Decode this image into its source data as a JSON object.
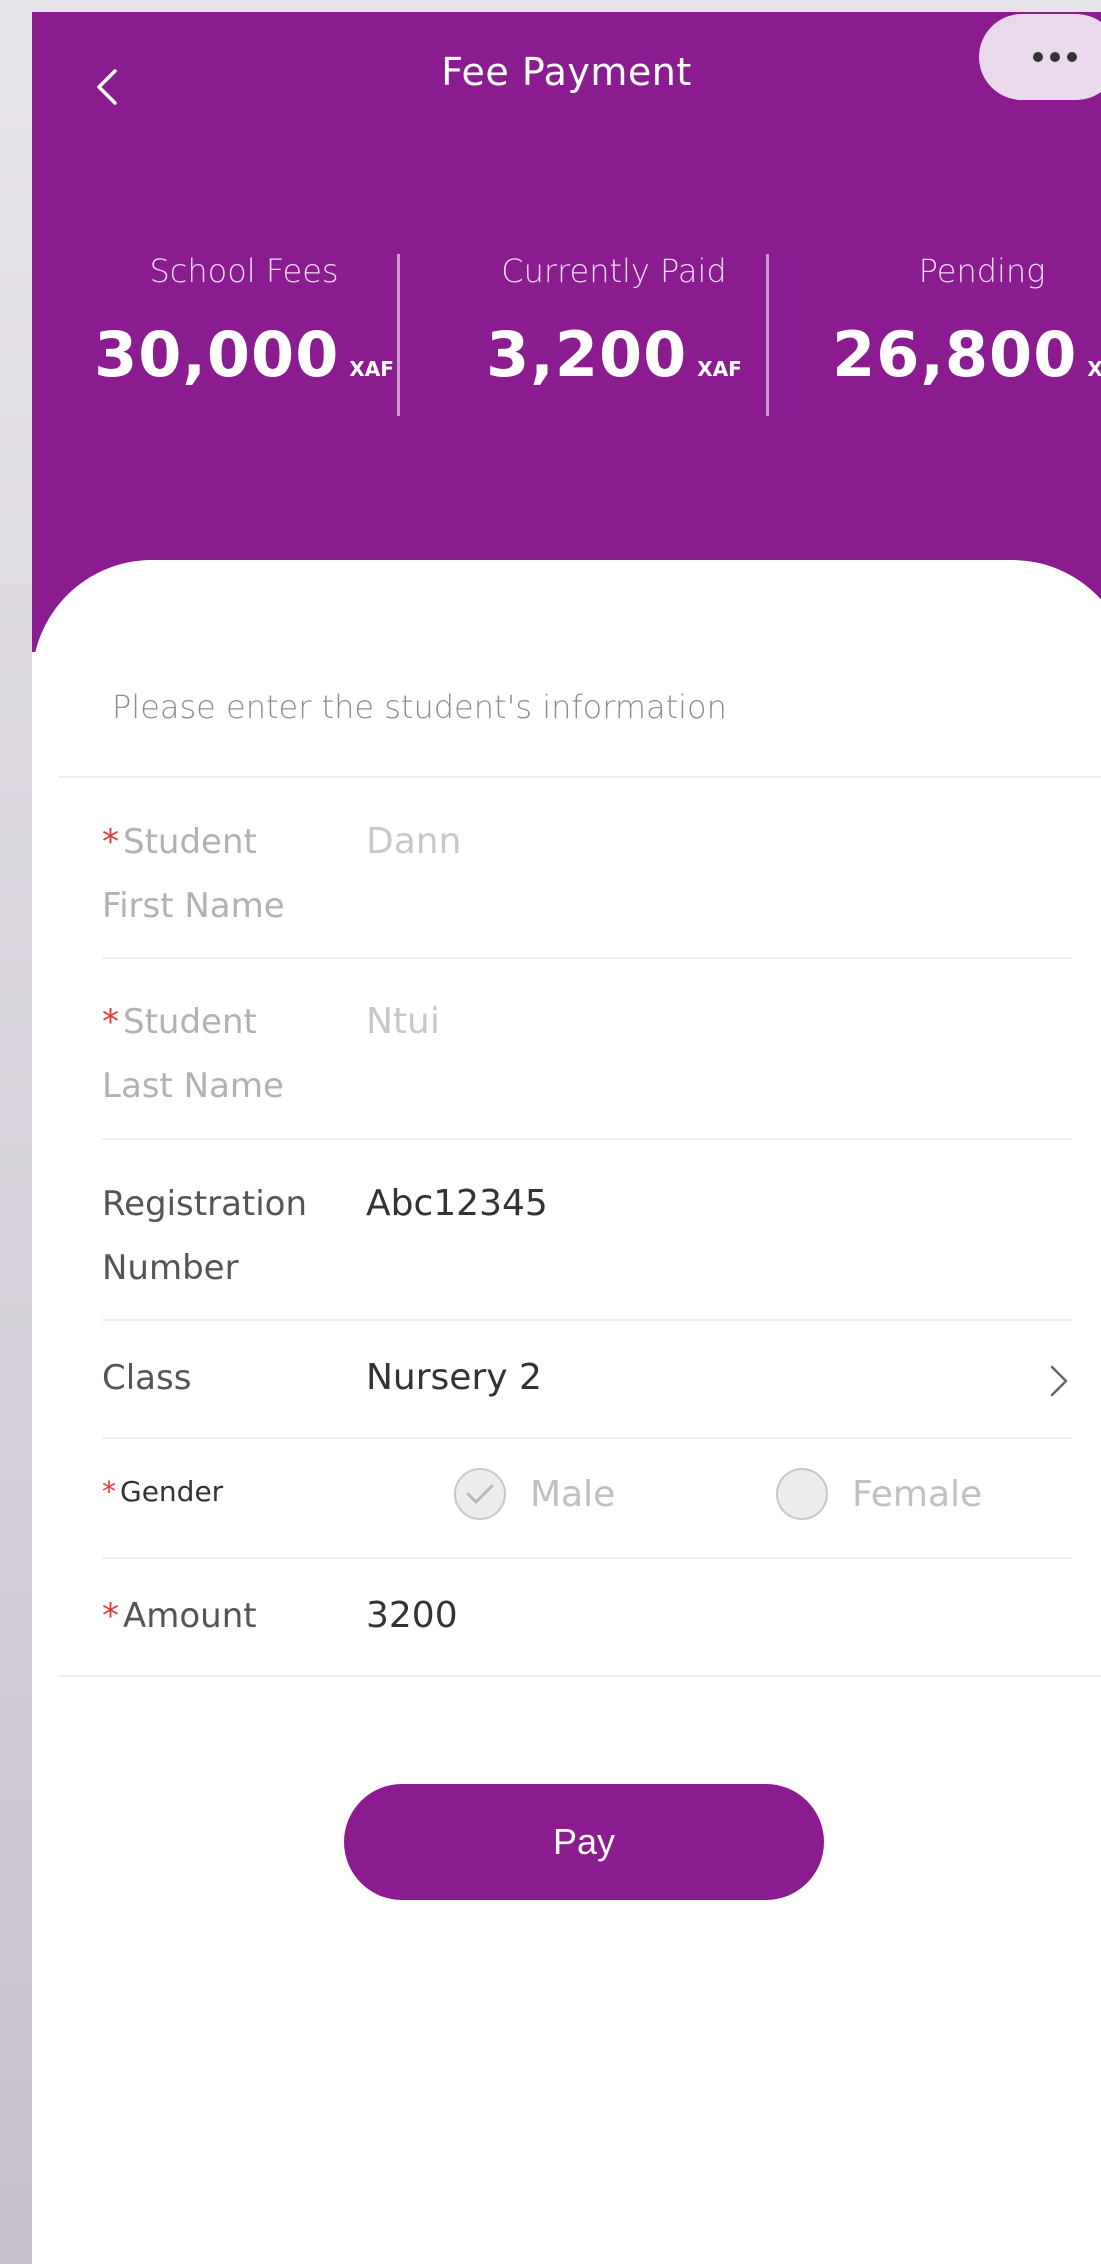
{
  "header": {
    "title": "Fee Payment",
    "back_icon": "chevron-left-icon",
    "more_icon": "more-horizontal-icon"
  },
  "stats": [
    {
      "label": "School Fees",
      "value": "30,000",
      "unit": "XAF"
    },
    {
      "label": "Currently Paid",
      "value": "3,200",
      "unit": "XAF"
    },
    {
      "label": "Pending",
      "value": "26,800",
      "unit": "XAF"
    }
  ],
  "form": {
    "intro": "Please enter the student's information",
    "required_mark": "*",
    "first_name": {
      "label_line1": "Student",
      "label_line2": "First Name",
      "placeholder": "Dann"
    },
    "last_name": {
      "label_line1": "Student",
      "label_line2": "Last Name",
      "placeholder": "Ntui"
    },
    "registration": {
      "label_line1": "Registration",
      "label_line2": "Number",
      "value": "Abc12345"
    },
    "class": {
      "label": "Class",
      "value": "Nursery 2"
    },
    "gender": {
      "label": "Gender",
      "options": [
        "Male",
        "Female"
      ],
      "selected": "Male"
    },
    "amount": {
      "label": "Amount",
      "value": "3200"
    }
  },
  "actions": {
    "pay_label": "Pay"
  },
  "colors": {
    "brand": "#8a1c8f",
    "required": "#e53935"
  }
}
